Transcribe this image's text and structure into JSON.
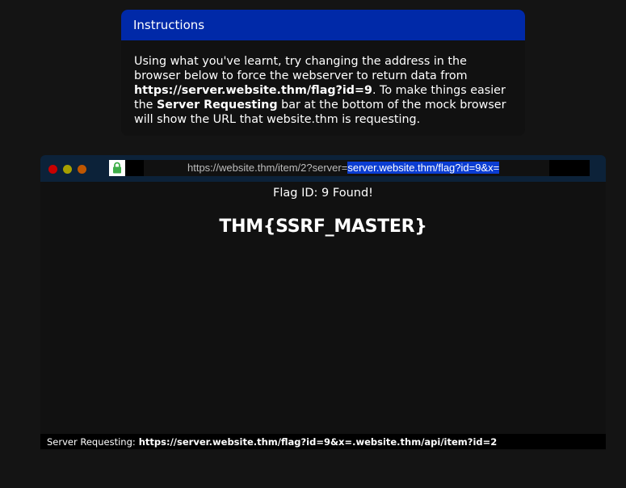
{
  "instructions": {
    "title": "Instructions",
    "text_1": "Using what you've learnt, try changing the address in the browser below to force the webserver to return data from ",
    "bold_url": "https://server.website.thm/flag?id=9",
    "text_2": ". To make things easier the ",
    "bold_bar": "Server Requesting",
    "text_3": " bar at the bottom of the mock browser will show the URL that website.thm is requesting."
  },
  "browser": {
    "url_prefix": "https://website.thm/item/2?server=",
    "url_selected": "server.website.thm/flag?id=9&x=",
    "flag_status": "Flag ID: 9 Found!",
    "flag_value": "THM{SSRF_MASTER}",
    "status_label": "Server Requesting:",
    "status_url": "https://server.website.thm/flag?id=9&x=.website.thm/api/item?id=2"
  },
  "colors": {
    "header_blue": "#0029a8",
    "toolbar_navy": "#0c2239",
    "selection_blue": "#0b3dd2",
    "lock_green": "#3fae49"
  },
  "icons": {
    "traffic_lights": [
      "close-dot",
      "minimize-dot",
      "maximize-dot"
    ],
    "secure": "lock-icon"
  }
}
